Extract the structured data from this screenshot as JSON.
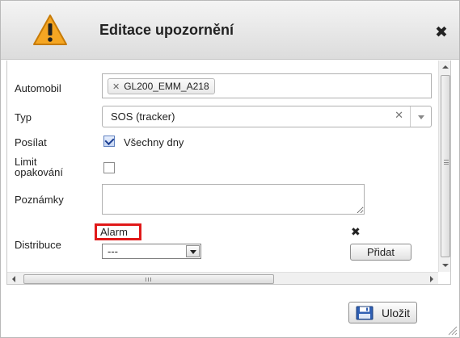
{
  "dialog": {
    "title": "Editace upozornění"
  },
  "form": {
    "vehicle_label": "Automobil",
    "vehicle_token": "GL200_EMM_A218",
    "type_label": "Typ",
    "type_value": "SOS (tracker)",
    "send_label": "Posílat",
    "send_option": "Všechny dny",
    "send_checked": true,
    "limit_label_line1": "Limit",
    "limit_label_line2": "opakování",
    "limit_checked": false,
    "notes_label": "Poznámky",
    "notes_value": "",
    "distribution_label": "Distribuce",
    "distribution_item": "Alarm",
    "distribution_select_value": "---",
    "add_button": "Přidat"
  },
  "footer": {
    "save_button": "Uložit"
  },
  "colors": {
    "highlight_border": "#e01919",
    "warning_yellow": "#f5a623"
  },
  "icons": [
    "warning-icon",
    "close-icon",
    "save-icon",
    "remove-icon"
  ]
}
